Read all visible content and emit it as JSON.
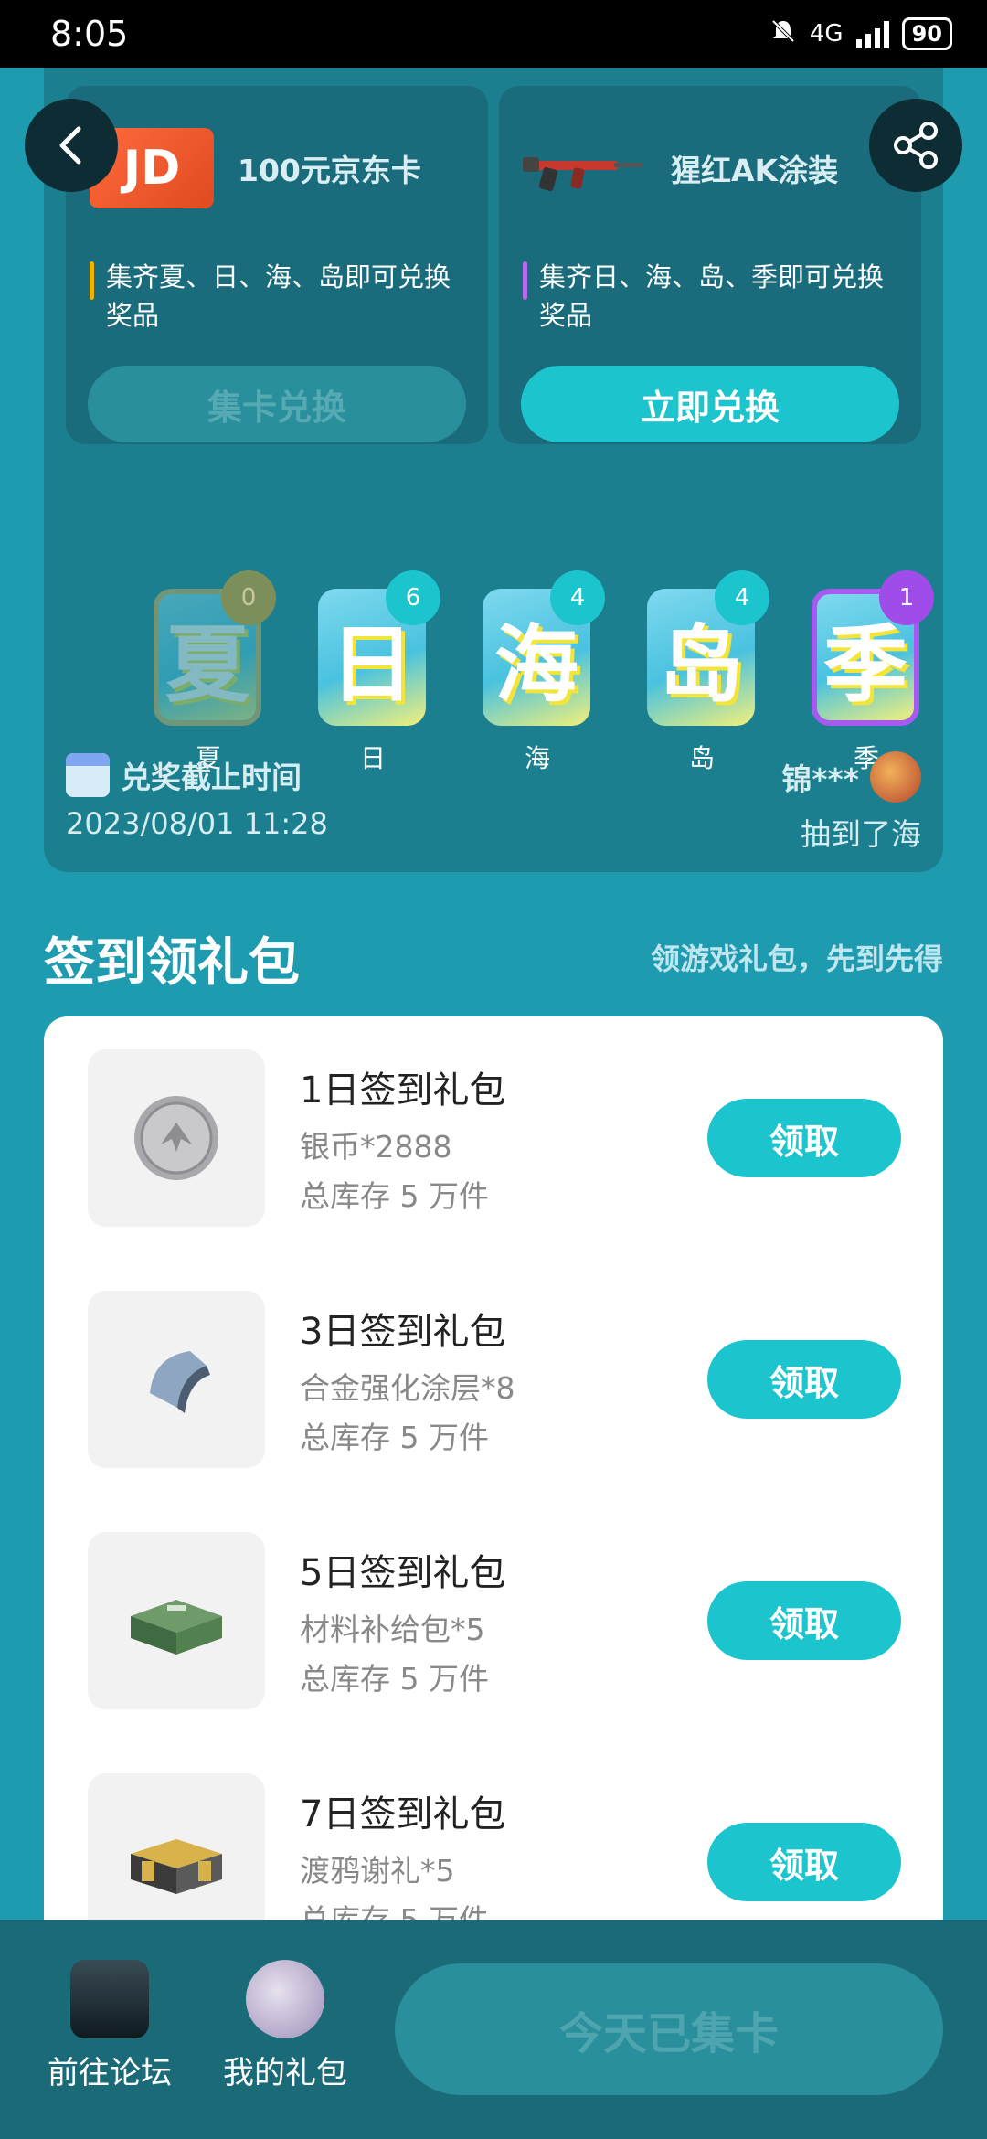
{
  "status_bar": {
    "time": "8:05",
    "network": "4G",
    "battery": "90"
  },
  "prizes": [
    {
      "name": "100元京东卡",
      "logo_text": "JD",
      "desc": "集齐夏、日、海、岛即可兑换奖品",
      "button": "集卡兑换"
    },
    {
      "name": "猩红AK涂装",
      "desc": "集齐日、海、岛、季即可兑换奖品",
      "button": "立即兑换"
    }
  ],
  "cards": [
    {
      "char": "夏",
      "label": "夏",
      "count": "0"
    },
    {
      "char": "日",
      "label": "日",
      "count": "6"
    },
    {
      "char": "海",
      "label": "海",
      "count": "4"
    },
    {
      "char": "岛",
      "label": "岛",
      "count": "4"
    },
    {
      "char": "季",
      "label": "季",
      "count": "1"
    }
  ],
  "deadline": {
    "title": "兑奖截止时间",
    "time": "2023/08/01 11:28"
  },
  "winner": {
    "name": "锦***",
    "result": "抽到了海"
  },
  "section": {
    "title": "签到领礼包",
    "subtitle": "领游戏礼包，先到先得"
  },
  "gifts": [
    {
      "name": "1日签到礼包",
      "item": "银币*2888",
      "stock": "总库存 5 万件",
      "button": "领取"
    },
    {
      "name": "3日签到礼包",
      "item": "合金强化涂层*8",
      "stock": "总库存 5 万件",
      "button": "领取"
    },
    {
      "name": "5日签到礼包",
      "item": "材料补给包*5",
      "stock": "总库存 5 万件",
      "button": "领取"
    },
    {
      "name": "7日签到礼包",
      "item": "渡鸦谢礼*5",
      "stock": "总库存 5 万件",
      "button": "领取"
    }
  ],
  "bottom_nav": {
    "forum_label": "前往论坛",
    "gifts_label": "我的礼包",
    "collect_button": "今天已集卡"
  },
  "icons": [
    "back-icon",
    "share-icon",
    "calendar-icon",
    "signal-icon",
    "battery-icon",
    "mute-icon"
  ],
  "colors": {
    "accent": "#1cc4ce",
    "background": "#1f9bb0",
    "panel": "#1b7f90",
    "disabled": "#2a8f9c"
  }
}
